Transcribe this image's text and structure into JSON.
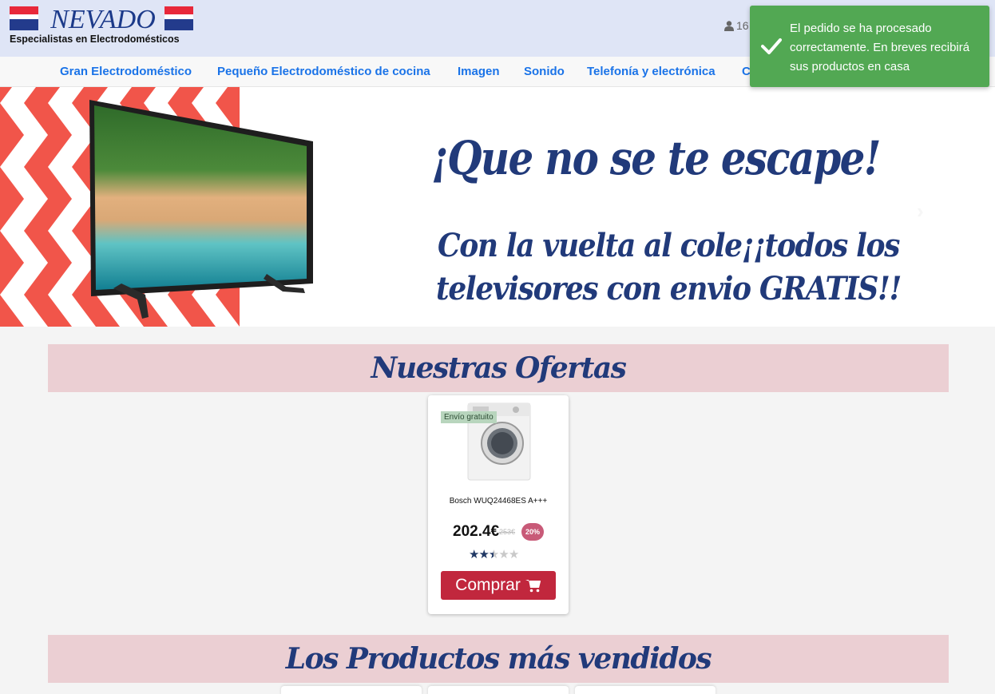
{
  "header": {
    "logo_brand": "NEVADO",
    "logo_tagline": "Especialistas en Electrodomésticos",
    "user_text": "16"
  },
  "nav": {
    "items": [
      "Gran Electrodoméstico",
      "Pequeño Electrodoméstico de cocina",
      "Imagen",
      "Sonido",
      "Telefonía y electrónica",
      "C"
    ]
  },
  "toast": {
    "message": "El pedido se ha procesado correctamente. En breves recibirá sus productos en casa",
    "color": "#52a853"
  },
  "banner": {
    "headline": "¡Que no se te escape!",
    "subline": "Con la vuelta al cole¡¡todos los televisores con envio GRATIS!!",
    "stripe_color": "#f1554a",
    "text_color": "#213a7a",
    "active_slide": 1,
    "slide_count": 3
  },
  "offers": {
    "title": "Nuestras Ofertas",
    "product": {
      "badge": "Envío gratuito",
      "name": "Bosch WUQ24468ES A+++",
      "price": "202.4€",
      "old_price": "253€",
      "discount": "20%",
      "rating": 2.5,
      "rating_max": 5,
      "buy_label": "Comprar",
      "icon": "cart-icon"
    }
  },
  "bestsellers": {
    "title": "Los Productos más vendidos"
  }
}
